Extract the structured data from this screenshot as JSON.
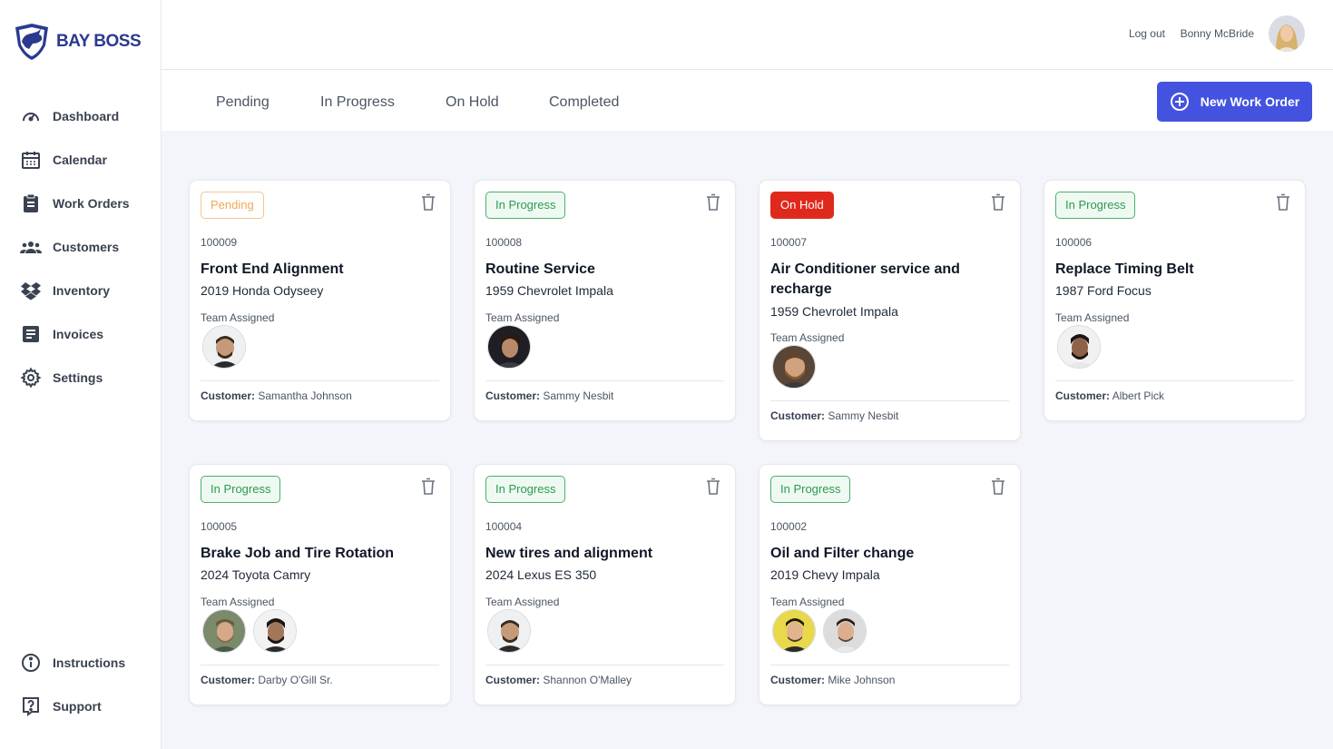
{
  "brand": {
    "name": "BAY BOSS",
    "color": "#2b3a8f"
  },
  "sidebar": {
    "items": [
      {
        "label": "Dashboard",
        "icon": "gauge-icon"
      },
      {
        "label": "Calendar",
        "icon": "calendar-icon"
      },
      {
        "label": "Work Orders",
        "icon": "clipboard-icon"
      },
      {
        "label": "Customers",
        "icon": "users-icon"
      },
      {
        "label": "Inventory",
        "icon": "boxes-icon"
      },
      {
        "label": "Invoices",
        "icon": "document-icon"
      },
      {
        "label": "Settings",
        "icon": "gear-icon"
      }
    ],
    "bottom_items": [
      {
        "label": "Instructions",
        "icon": "info-icon"
      },
      {
        "label": "Support",
        "icon": "question-icon"
      }
    ]
  },
  "header": {
    "logout_label": "Log out",
    "user_name": "Bonny McBride"
  },
  "tabs": [
    "Pending",
    "In Progress",
    "On Hold",
    "Completed"
  ],
  "new_button_label": "New Work Order",
  "colors": {
    "accent": "#4353e0",
    "pending": "#f0a856",
    "in_progress": "#2e9a4f",
    "on_hold": "#e0291d",
    "background": "#f3f5fa"
  },
  "team_label": "Team Assigned",
  "customer_label": "Customer:",
  "work_orders": [
    {
      "status": "Pending",
      "number": "100009",
      "title": "Front End Alignment",
      "vehicle": "2019 Honda Odyseey",
      "customer": "Samantha Johnson"
    },
    {
      "status": "In Progress",
      "number": "100008",
      "title": "Routine Service",
      "vehicle": "1959 Chevrolet Impala",
      "customer": "Sammy Nesbit"
    },
    {
      "status": "On Hold",
      "number": "100007",
      "title": "Air Conditioner service and recharge",
      "vehicle": "1959 Chevrolet Impala",
      "customer": "Sammy Nesbit"
    },
    {
      "status": "In Progress",
      "number": "100006",
      "title": "Replace Timing Belt",
      "vehicle": "1987 Ford Focus",
      "customer": "Albert Pick"
    },
    {
      "status": "In Progress",
      "number": "100005",
      "title": "Brake Job and Tire Rotation",
      "vehicle": "2024 Toyota Camry",
      "customer": "Darby O'Gill Sr."
    },
    {
      "status": "In Progress",
      "number": "100004",
      "title": "New tires and alignment",
      "vehicle": "2024 Lexus ES 350",
      "customer": "Shannon O'Malley"
    },
    {
      "status": "In Progress",
      "number": "100002",
      "title": "Oil and Filter change",
      "vehicle": "2019 Chevy Impala",
      "customer": "Mike Johnson"
    }
  ]
}
